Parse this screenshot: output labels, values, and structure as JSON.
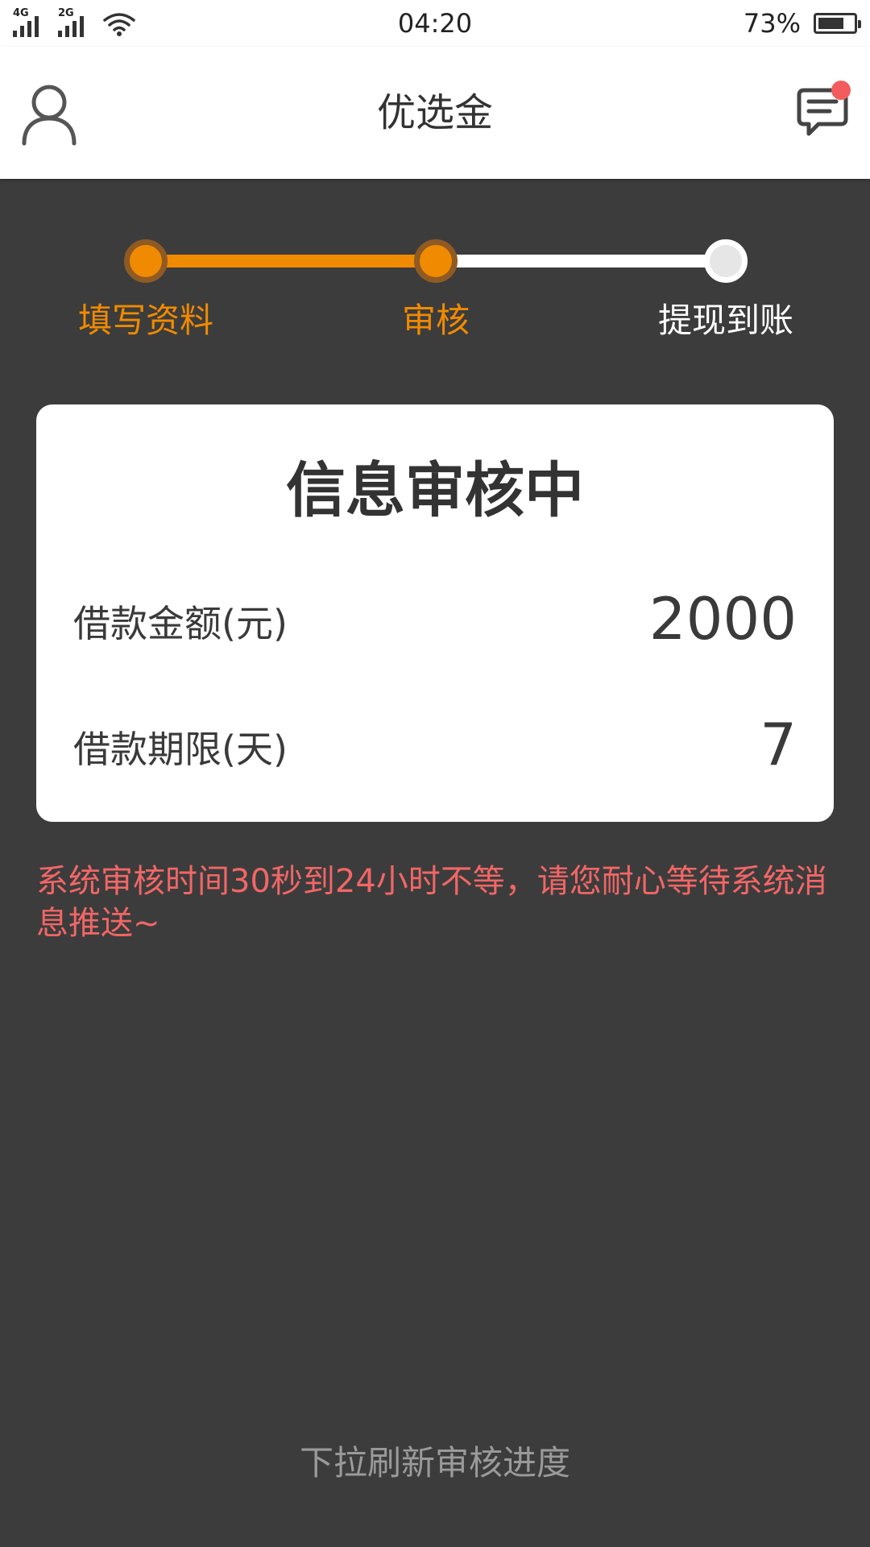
{
  "status_bar": {
    "network_1": "4G",
    "network_2": "2G",
    "time": "04:20",
    "battery_percent": "73%",
    "battery_level": 0.73
  },
  "header": {
    "title": "优选金",
    "left_icon": "user-profile-icon",
    "right_icon": "message-chat-icon",
    "has_notification": true
  },
  "steps": [
    {
      "label": "填写资料",
      "state": "done"
    },
    {
      "label": "审核",
      "state": "done"
    },
    {
      "label": "提现到账",
      "state": "pending"
    }
  ],
  "card": {
    "title": "信息审核中",
    "rows": [
      {
        "label": "借款金额(元)",
        "value": "2000"
      },
      {
        "label": "借款期限(天)",
        "value": "7"
      }
    ]
  },
  "notice": "系统审核时间30秒到24小时不等，请您耐心等待系统消息推送~",
  "refresh_hint": "下拉刷新审核进度",
  "colors": {
    "accent": "#f08a00",
    "background": "#3c3c3c",
    "card": "#ffffff",
    "notice": "#f26666",
    "notify_dot": "#f25c5c",
    "pending_dot": "#e6e6e6",
    "pending_line": "#ffffff",
    "pending_label": "#ffffff"
  }
}
